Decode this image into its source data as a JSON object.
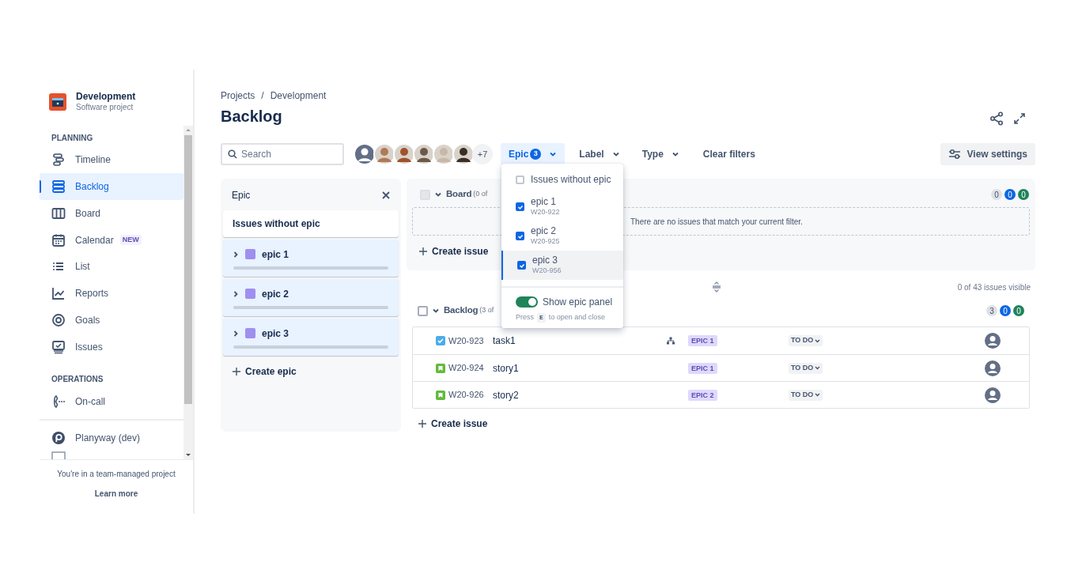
{
  "project": {
    "name": "Development",
    "subtitle": "Software project"
  },
  "sidebar": {
    "sections": [
      {
        "heading": "PLANNING",
        "items": [
          {
            "label": "Timeline",
            "kind": "timeline",
            "selected": false
          },
          {
            "label": "Backlog",
            "kind": "backlog",
            "selected": true
          },
          {
            "label": "Board",
            "kind": "board",
            "selected": false
          },
          {
            "label": "Calendar",
            "kind": "calendar",
            "selected": false,
            "badge": "NEW"
          },
          {
            "label": "List",
            "kind": "list",
            "selected": false
          },
          {
            "label": "Reports",
            "kind": "reports",
            "selected": false
          },
          {
            "label": "Goals",
            "kind": "goals",
            "selected": false
          },
          {
            "label": "Issues",
            "kind": "issues",
            "selected": false
          }
        ]
      },
      {
        "heading": "OPERATIONS",
        "items": [
          {
            "label": "On-call",
            "kind": "oncall",
            "selected": false
          }
        ]
      }
    ],
    "apps": [
      {
        "label": "Planyway (dev)",
        "kind": "planyway"
      },
      {
        "kind": "cut"
      }
    ],
    "footer": "You're in a team-managed project",
    "footer_link": "Learn more"
  },
  "breadcrumbs": {
    "items": [
      "Projects",
      "Development"
    ],
    "separator": "/"
  },
  "title": "Backlog",
  "search": {
    "placeholder": "Search"
  },
  "avatars": [
    {
      "kind": "placeholder"
    },
    {
      "kind": "photo",
      "color": "#b07a55"
    },
    {
      "kind": "photo",
      "color": "#a0522d"
    },
    {
      "kind": "photo",
      "color": "#6b5a4a"
    },
    {
      "kind": "photo",
      "color": "#c9b8a8"
    },
    {
      "kind": "photo",
      "color": "#3a2e28"
    }
  ],
  "avatars_more": "+7",
  "filters": [
    {
      "label": "Epic",
      "count": "3",
      "open": true
    },
    {
      "label": "Label",
      "open": false
    },
    {
      "label": "Type",
      "open": false
    }
  ],
  "clear_filters": "Clear filters",
  "view_settings": "View settings",
  "epic_panel": {
    "title": "Epic",
    "without": "Issues without epic",
    "epics": [
      {
        "name": "epic 1",
        "color": "#9f8fef",
        "expanded": false,
        "level": 0
      },
      {
        "name": "epic 2",
        "color": "#9f8fef",
        "expanded": false,
        "level": 0
      },
      {
        "name": "epic 3",
        "color": "#9f8fef",
        "expanded": false,
        "level": 0
      }
    ],
    "create": "Create epic"
  },
  "epic_dropdown": {
    "options": [
      {
        "label": "Issues without epic",
        "checked": false,
        "selected": false
      },
      {
        "label": "epic 1",
        "key": "W20-922",
        "checked": true,
        "selected": false
      },
      {
        "label": "epic 2",
        "key": "W20-925",
        "checked": true,
        "selected": false
      },
      {
        "label": "epic 3",
        "key": "W20-956",
        "checked": true,
        "selected": true
      }
    ],
    "toggle": {
      "label": "Show epic panel",
      "on": true
    },
    "hint": [
      "Press",
      "E",
      "to open and close"
    ]
  },
  "sprint": {
    "name": "Board",
    "count": "(0 of",
    "expanded": true,
    "checked": false,
    "disabled": true,
    "badges": [
      {
        "text": "0",
        "color": "#dfe1e6"
      },
      {
        "text": "0",
        "color": "#0c66e4"
      },
      {
        "text": "0",
        "color": "#1f845a"
      }
    ],
    "empty": "There are no issues that match your current filter.",
    "create": "Create issue"
  },
  "visible_count": "0 of 43 issues visible",
  "backlog": {
    "name": "Backlog",
    "count": "(3 of",
    "expanded": true,
    "checked": false,
    "disabled": false,
    "badges": [
      {
        "text": "3",
        "color": "#dfe1e6"
      },
      {
        "text": "0",
        "color": "#0c66e4"
      },
      {
        "text": "0",
        "color": "#1f845a"
      }
    ],
    "issues": [
      {
        "kind": "task",
        "key": "W20-923",
        "summary": "task1",
        "subtasks": true,
        "epic": "EPIC 1",
        "status": "TO DO"
      },
      {
        "kind": "story",
        "key": "W20-924",
        "summary": "story1",
        "subtasks": false,
        "epic": "EPIC 1",
        "status": "TO DO"
      },
      {
        "kind": "story",
        "key": "W20-926",
        "summary": "story2",
        "subtasks": false,
        "epic": "EPIC 2",
        "status": "TO DO"
      }
    ],
    "create": "Create issue"
  }
}
